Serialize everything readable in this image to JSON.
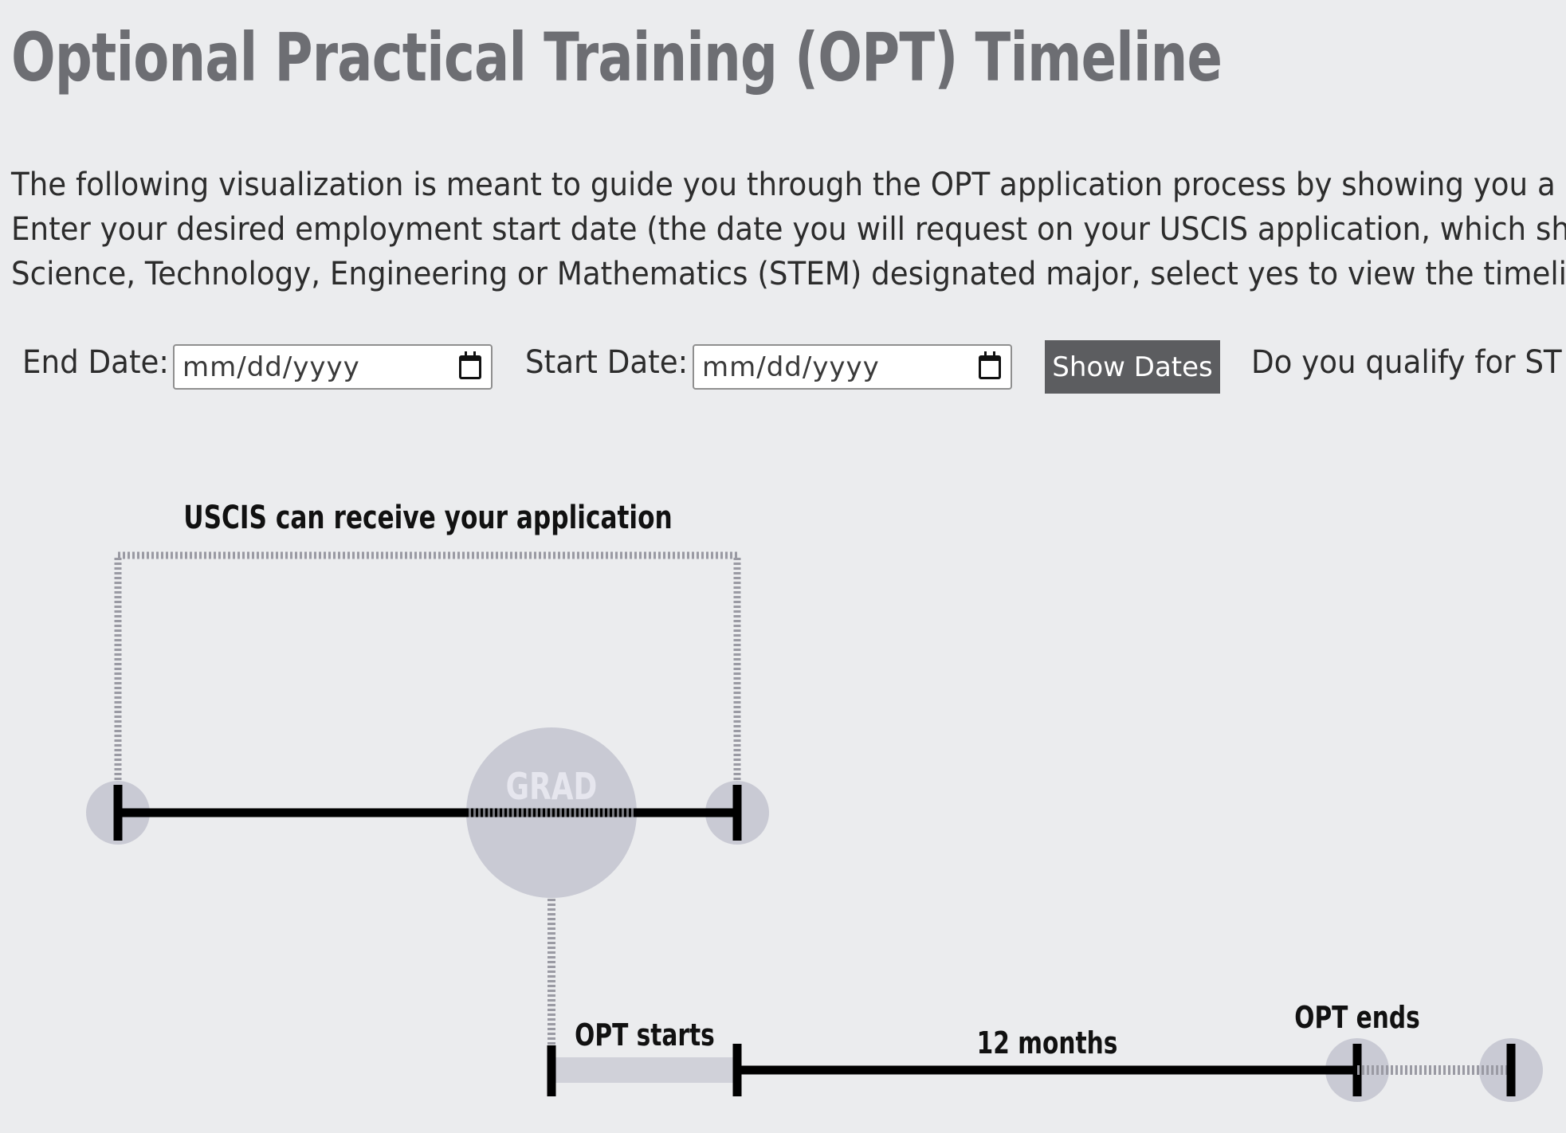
{
  "page": {
    "title": "Optional Practical Training (OPT) Timeline",
    "intro_lines": [
      "The following visualization is meant to guide you through the OPT application process by showing you a",
      "Enter your desired employment start date (the date you will request on your USCIS application, which sho",
      "Science, Technology, Engineering or Mathematics (STEM) designated major, select yes to view the timeli"
    ]
  },
  "form": {
    "end_date_label": "End Date:",
    "end_date_placeholder": "mm/dd/yyyy",
    "start_date_label": "Start Date:",
    "start_date_placeholder": "mm/dd/yyyy",
    "show_button_label": "Show Dates",
    "stem_question": "Do you qualify for ST"
  },
  "timeline": {
    "receive_window_label": "USCIS can receive your application",
    "grad_label": "GRAD",
    "opt_starts_label": "OPT starts",
    "duration_label": "12 months",
    "opt_ends_label": "OPT ends",
    "colors": {
      "bar": "#000000",
      "dotted": "#9a9aa3",
      "node": "#c9cad4",
      "grad_text": "#e6e6ee",
      "start_segment": "#d0d1d9"
    }
  }
}
